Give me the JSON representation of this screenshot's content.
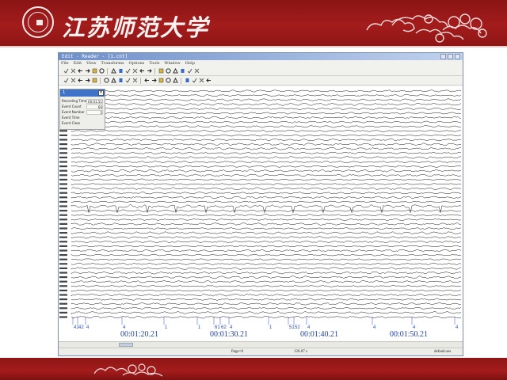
{
  "banner": {
    "university_name": "江苏师范大学",
    "color_primary": "#a41c1c",
    "color_text": "#fbf1f1"
  },
  "window": {
    "title": "Edit - Reader - [1.cnt]",
    "menus": [
      "File",
      "Edit",
      "View",
      "Transforms",
      "Options",
      "Tools",
      "Window",
      "Help"
    ],
    "toolbar_row1_icons": [
      "checkmark-icon",
      "checkmark-icon",
      "arrow-left-icon",
      "arrow-right-icon",
      "cross-icon",
      "checkmark-icon",
      "rewind-icon",
      "step-back-icon",
      "step-forward-icon",
      "fast-forward-icon",
      "checkmark-icon",
      "cross-icon",
      "refresh-icon",
      "clock-icon",
      "box-icon",
      "amplitude-icon",
      "text-a-icon",
      "triangle-icon"
    ],
    "toolbar_row2_icons": [
      "open-icon",
      "save-icon",
      "print-icon",
      "copy-icon",
      "arrow-up-icon",
      "arrow-down-icon",
      "vertical-scale-icon",
      "spread-icon",
      "compress-icon",
      "baseline-icon",
      "filter-icon",
      "zoom-in-icon",
      "zoom-out-icon",
      "marker-icon",
      "montage-icon",
      "grid-icon",
      "color-icon",
      "note-icon",
      "settings-icon"
    ]
  },
  "event_panel": {
    "header": "1",
    "rows": [
      {
        "label": "Recording Time",
        "value": "00:01:51"
      },
      {
        "label": "Event Count",
        "value": "66"
      },
      {
        "label": "Event Number",
        "value": "5"
      },
      {
        "label": "Event Time",
        "value": ""
      },
      {
        "label": "Event Class",
        "value": ""
      }
    ]
  },
  "timeline": {
    "time_labels": [
      "00:01:20.21",
      "00:01:30.21",
      "00:01:40.21",
      "00:01:50.21"
    ],
    "event_markers": [
      "41",
      "42",
      "4",
      "4",
      "1",
      "1",
      "61",
      "62",
      "4",
      "1",
      "51",
      "52",
      "4",
      "4",
      "4",
      "4"
    ]
  },
  "status": {
    "page": "Page=0",
    "scale": "120.07 s",
    "setting": "default.ses"
  },
  "trace_colors": {
    "trace": "#1a1a1a",
    "marker": "#2a4fc0"
  }
}
